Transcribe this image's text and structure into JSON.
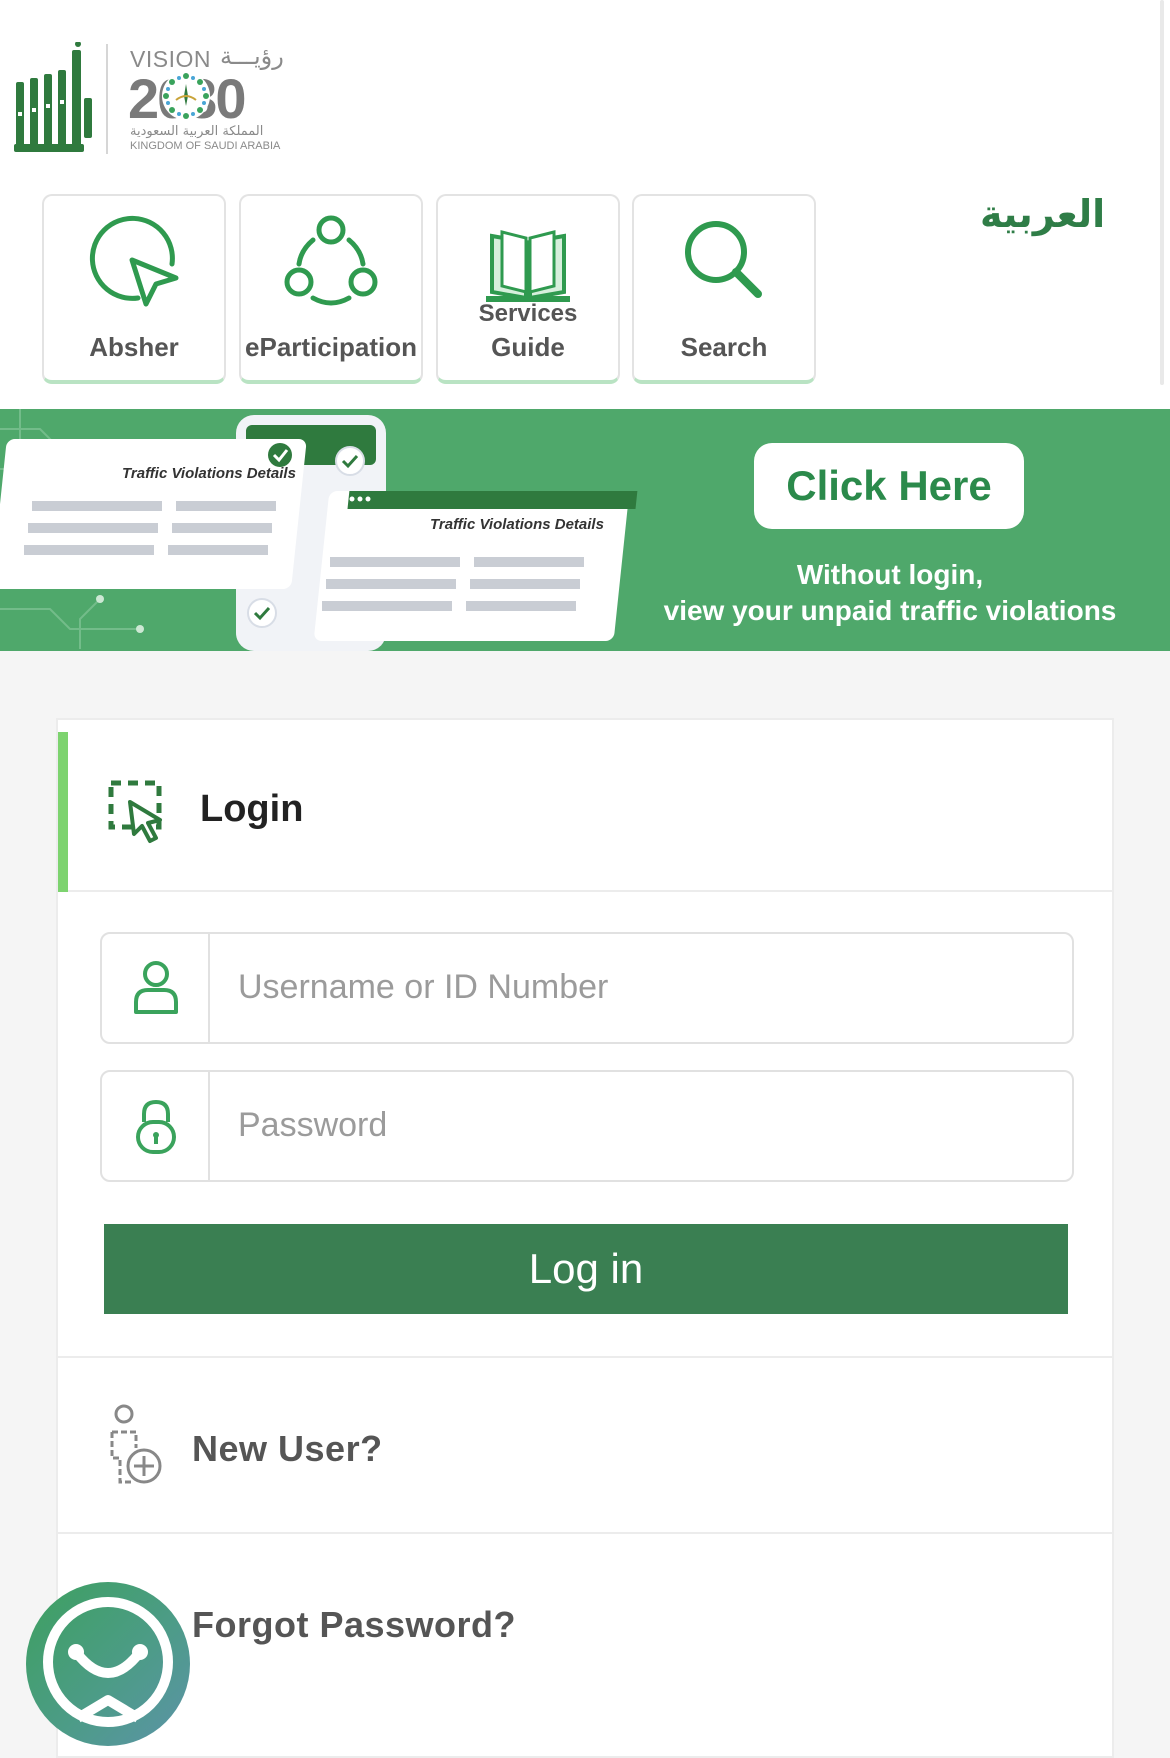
{
  "header": {
    "logo_alt": "أبشر",
    "vision": {
      "word": "VISION",
      "arabic": "رؤيـــة",
      "year": "2030",
      "kingdom_ar": "المملكة العربية السعودية",
      "kingdom_en": "KINGDOM OF SAUDI ARABIA"
    },
    "language_link": "العربية"
  },
  "nav_cards": [
    {
      "label": "Absher",
      "icon": "cursor-circle-icon"
    },
    {
      "label": "eParticipation",
      "icon": "network-people-icon"
    },
    {
      "label": "Guide",
      "sublabel": "Services",
      "icon": "open-book-icon"
    },
    {
      "label": "Search",
      "icon": "search-icon"
    }
  ],
  "banner": {
    "card_title_1": "Traffic Violations Details",
    "card_title_2": "Traffic Violations Details",
    "cta_label": "Click Here",
    "subtitle_line1": "Without login,",
    "subtitle_line2": "view your unpaid traffic violations"
  },
  "login": {
    "title": "Login",
    "username_placeholder": "Username or ID Number",
    "password_placeholder": "Password",
    "submit_label": "Log in",
    "new_user_label": "New User?",
    "forgot_password_label": "Forgot Password?"
  },
  "colors": {
    "brand_green": "#3a7f52",
    "banner_green": "#4fa86b",
    "accent_light_green": "#7dd36f"
  }
}
